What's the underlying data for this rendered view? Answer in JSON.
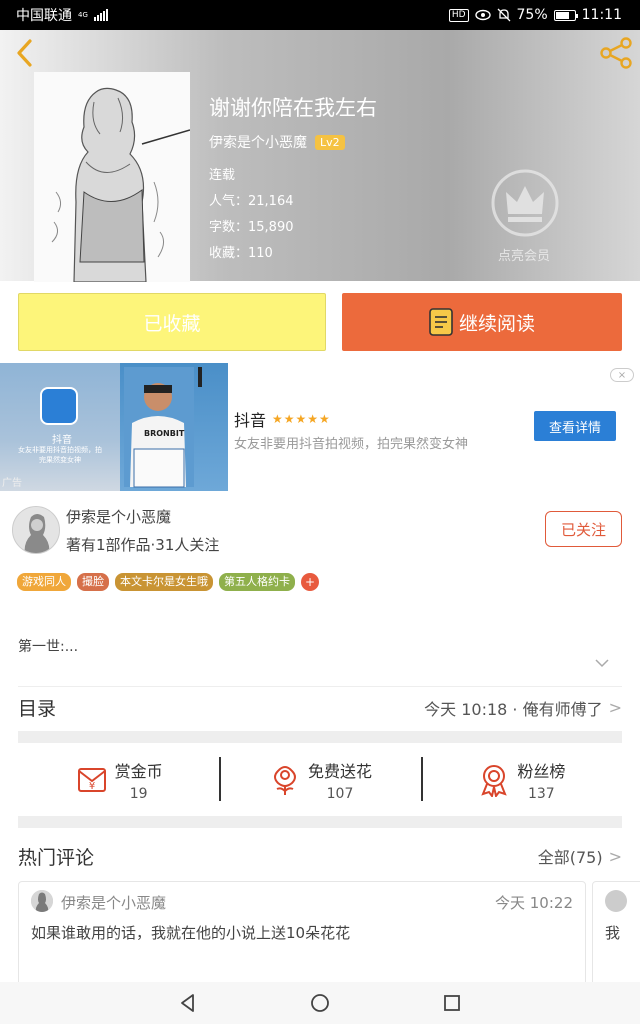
{
  "status_bar": {
    "carrier": "中国联通",
    "network": "4G",
    "hd": "HD",
    "battery": "75%",
    "battery_level": 0.75,
    "time": "11:11"
  },
  "header": {
    "book_title": "谢谢你陪在我左右",
    "author": "伊索是个小恶魔",
    "level": "Lv2",
    "status": "连载",
    "popularity": "人气：21,164",
    "word_count": "字数：15,890",
    "favorites": "收藏：110",
    "vip_label": "点亮会员",
    "icons": {
      "back": "back-icon",
      "share": "share-icon",
      "vip": "crown-icon"
    }
  },
  "actions": {
    "collected_label": "已收藏",
    "continue_label": "继续阅读"
  },
  "ad": {
    "app_name": "抖音",
    "stars": "★★★★★",
    "description": "女友非要用抖音拍视频，拍完果然变女神",
    "cta": "查看详情",
    "ad_tag": "广告",
    "close": "×",
    "mini_title": "抖音",
    "mini_text": "女友非要用抖音拍视频，拍完果然变女神",
    "shirt_text": "BRONBIT"
  },
  "author_row": {
    "name": "伊索是个小恶魔",
    "stats": "著有1部作品·31人关注",
    "follow_label": "已关注"
  },
  "tags": [
    {
      "label": "游戏同人",
      "color": "#f0a73a"
    },
    {
      "label": "撮脸",
      "color": "#d6704a"
    },
    {
      "label": "本文卡尔是女生哦",
      "color": "#c99434"
    },
    {
      "label": "第五人格约卡",
      "color": "#8fb04c"
    }
  ],
  "tag_plus": "+",
  "intro": "第一世:...",
  "catalog": {
    "title": "目录",
    "latest": "今天 10:18 · 俺有师傅了"
  },
  "stats": [
    {
      "label": "赏金币",
      "value": "19",
      "icon": "coin-envelope-icon"
    },
    {
      "label": "免费送花",
      "value": "107",
      "icon": "flower-icon"
    },
    {
      "label": "粉丝榜",
      "value": "137",
      "icon": "medal-icon"
    }
  ],
  "comments": {
    "title": "热门评论",
    "all_label": "全部(75)",
    "items": [
      {
        "user": "伊索是个小恶魔",
        "time": "今天 10:22",
        "text": "如果谁敢用的话，我就在他的小说上送10朵花花"
      },
      {
        "text": "我"
      }
    ]
  },
  "colors": {
    "accent": "#ec6a3c",
    "collected_bg": "#fdf57a",
    "follow": "#e05a3a",
    "ad_button": "#2b7fd6"
  }
}
